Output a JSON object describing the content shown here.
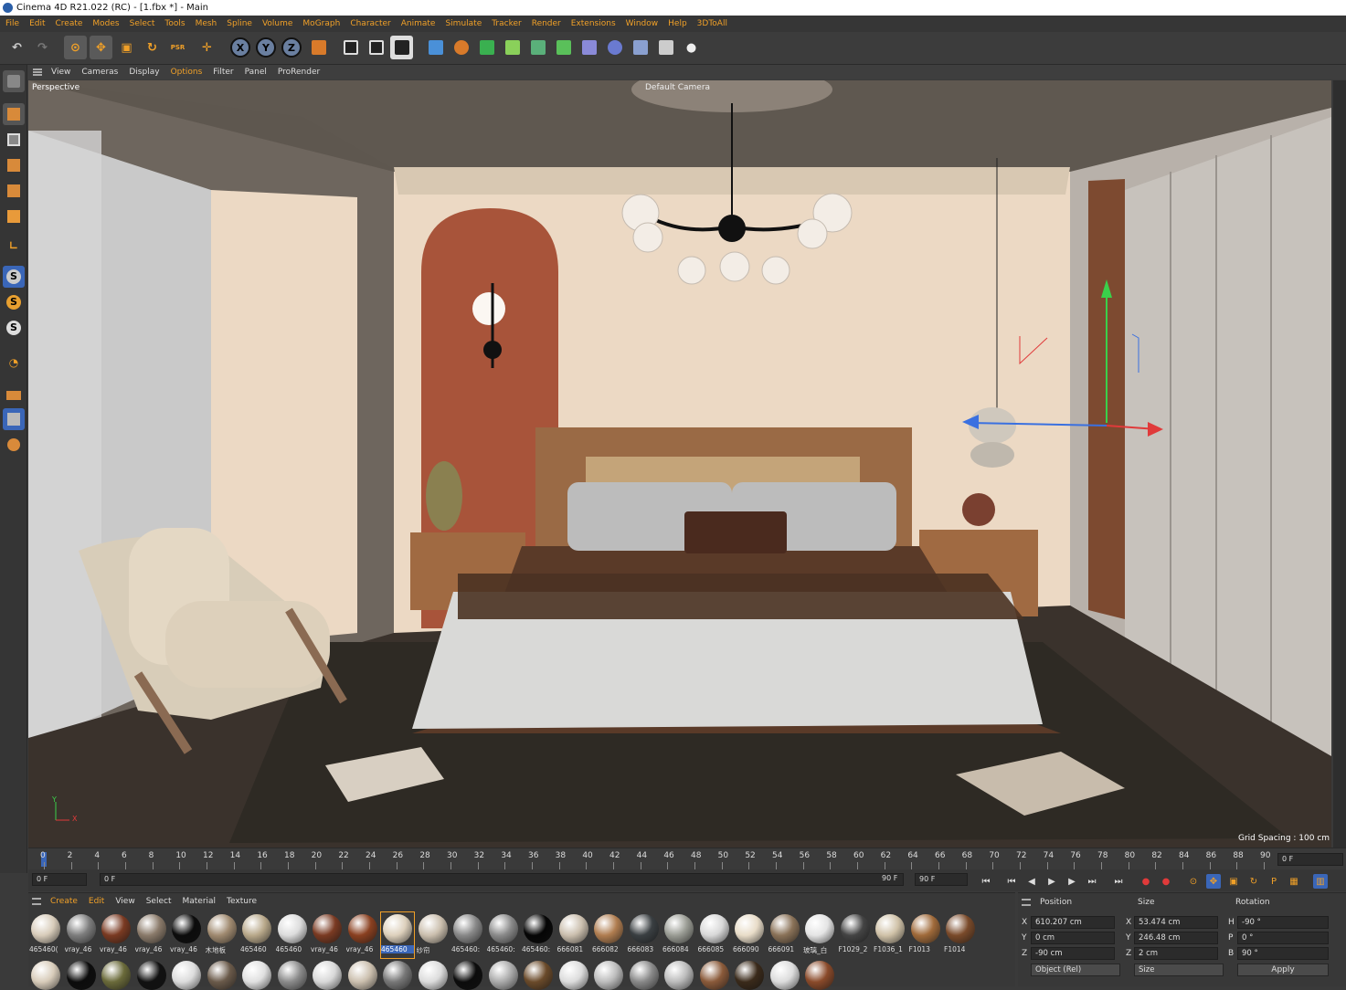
{
  "window": {
    "title": "Cinema 4D R21.022 (RC) - [1.fbx *] - Main"
  },
  "menu": [
    "File",
    "Edit",
    "Create",
    "Modes",
    "Select",
    "Tools",
    "Mesh",
    "Spline",
    "Volume",
    "MoGraph",
    "Character",
    "Animate",
    "Simulate",
    "Tracker",
    "Render",
    "Extensions",
    "Window",
    "Help",
    "3DToAll"
  ],
  "toolbar": {
    "undo": "undo-icon",
    "redo": "redo-icon",
    "axis_x": "X",
    "axis_y": "Y",
    "axis_z": "Z",
    "psr": "PSR"
  },
  "viewport_menu": [
    "View",
    "Cameras",
    "Display",
    "Options",
    "Filter",
    "Panel",
    "ProRender"
  ],
  "viewport": {
    "name": "Perspective",
    "camera": "Default Camera",
    "grid_spacing": "Grid Spacing : 100 cm",
    "axis_y": "Y",
    "axis_x": "X"
  },
  "timeline": {
    "ticks": [
      "0",
      "2",
      "4",
      "6",
      "8",
      "10",
      "12",
      "14",
      "16",
      "18",
      "20",
      "22",
      "24",
      "26",
      "28",
      "30",
      "32",
      "34",
      "36",
      "38",
      "40",
      "42",
      "44",
      "46",
      "48",
      "50",
      "52",
      "54",
      "56",
      "58",
      "60",
      "62",
      "64",
      "66",
      "68",
      "70",
      "72",
      "74",
      "76",
      "78",
      "80",
      "82",
      "84",
      "86",
      "88",
      "90"
    ],
    "end_frame": "0 F"
  },
  "playback": {
    "current": "0 F",
    "start": "0 F",
    "end_a": "90 F",
    "end_b": "90 F"
  },
  "materials": {
    "menu": [
      "Create",
      "Edit",
      "View",
      "Select",
      "Material",
      "Texture"
    ],
    "items": [
      {
        "label": "465460(",
        "color": "#d8ccba"
      },
      {
        "label": "vray_46",
        "color": "#7d7d7d"
      },
      {
        "label": "vray_46",
        "color": "#7a3a22"
      },
      {
        "label": "vray_46",
        "color": "#8a7a6a"
      },
      {
        "label": "vray_46",
        "color": "#0c0c0c"
      },
      {
        "label": "木地板",
        "color": "#a08a70"
      },
      {
        "label": "465460",
        "color": "#b8a88a"
      },
      {
        "label": "465460",
        "color": "#dcdcdc"
      },
      {
        "label": "vray_46",
        "color": "#7a3a22"
      },
      {
        "label": "vray_46",
        "color": "#8a4020"
      },
      {
        "label": "465460",
        "color": "#ddd0bc"
      },
      {
        "label": "纱帘",
        "color": "#cbbfae"
      },
      {
        "label": "465460:",
        "color": "#888888"
      },
      {
        "label": "465460:",
        "color": "#8a8a8a"
      },
      {
        "label": "465460:",
        "color": "#050505"
      },
      {
        "label": "666081",
        "color": "#cbbfae"
      },
      {
        "label": "666082",
        "color": "#b07d50"
      },
      {
        "label": "666083",
        "color": "#3a3f42"
      },
      {
        "label": "666084",
        "color": "#9a9c94"
      },
      {
        "label": "666085",
        "color": "#d8d8d8"
      },
      {
        "label": "666090",
        "color": "#e8dcc8"
      },
      {
        "label": "666091",
        "color": "#8a7258"
      },
      {
        "label": "玻璃_白",
        "color": "#e4e4e4"
      },
      {
        "label": "F1029_2",
        "color": "#444444"
      },
      {
        "label": "F1036_1",
        "color": "#d0c2a8"
      },
      {
        "label": "F1013",
        "color": "#a06a3a"
      },
      {
        "label": "F1014",
        "color": "#7a4a2a"
      }
    ],
    "row2": [
      "#d8ccba",
      "#0c0c0c",
      "#6a6a3a",
      "#111111",
      "#dcdcdc",
      "#6a5a4a",
      "#e0e0e0",
      "#8a8a8a",
      "#d8d8d8",
      "#cbbfae",
      "#777777",
      "#dcdcdc",
      "#0c0c0c",
      "#aaaaaa",
      "#6a4a2a",
      "#dcdcdc",
      "#bcbcbc",
      "#888888",
      "#bbbbbb",
      "#8a5a3a",
      "#3a2a1a",
      "#dcdcdc",
      "#8a4a2a"
    ]
  },
  "attributes": {
    "headers": {
      "position": "Position",
      "size": "Size",
      "rotation": "Rotation"
    },
    "position": {
      "x": "610.207 cm",
      "y": "0 cm",
      "z": "-90 cm"
    },
    "size": {
      "x": "53.474 cm",
      "y": "246.48 cm",
      "z": "2 cm"
    },
    "rotation": {
      "h": "-90 °",
      "p": "0 °",
      "b": "90 °"
    },
    "labels": {
      "x": "X",
      "y": "Y",
      "z": "Z",
      "sx": "X",
      "sy": "Y",
      "sz": "Z",
      "h": "H",
      "p": "P",
      "b": "B"
    },
    "coord_mode": "Object (Rel)",
    "size_mode": "Size",
    "apply": "Apply"
  },
  "colors": {
    "accent": "#f0a028",
    "ui_bg": "#3a3a3a",
    "selection": "#3a66b8"
  }
}
